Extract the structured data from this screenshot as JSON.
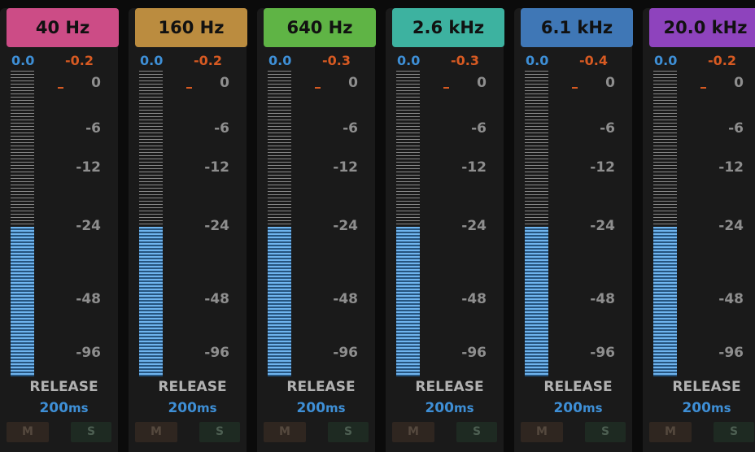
{
  "colors": {
    "gain_value": "#3e8fd6",
    "reduction_value": "#d75a22",
    "meter_active": "#6fb4ee",
    "meter_inactive": "#8a8a8a",
    "scale_text": "#8e8e8e",
    "panel_bg": "#1a1a1a",
    "app_bg": "#0b0b0b"
  },
  "scale": [
    "0",
    "-6",
    "-12",
    "-24",
    "-48",
    "-96"
  ],
  "release_label": "RELEASE",
  "mute_label": "M",
  "solo_label": "S",
  "bands": [
    {
      "label": "40 Hz",
      "color": "#cc4c86",
      "gain": "0.0",
      "reduction": "-0.2",
      "release_value": "200",
      "release_unit": "ms",
      "meter_level_fraction": 0.49
    },
    {
      "label": "160 Hz",
      "color": "#bb8c3f",
      "gain": "0.0",
      "reduction": "-0.2",
      "release_value": "200",
      "release_unit": "ms",
      "meter_level_fraction": 0.49
    },
    {
      "label": "640 Hz",
      "color": "#5fb445",
      "gain": "0.0",
      "reduction": "-0.3",
      "release_value": "200",
      "release_unit": "ms",
      "meter_level_fraction": 0.49
    },
    {
      "label": "2.6 kHz",
      "color": "#3db2a0",
      "gain": "0.0",
      "reduction": "-0.3",
      "release_value": "200",
      "release_unit": "ms",
      "meter_level_fraction": 0.49
    },
    {
      "label": "6.1 kHz",
      "color": "#3f77b6",
      "gain": "0.0",
      "reduction": "-0.4",
      "release_value": "200",
      "release_unit": "ms",
      "meter_level_fraction": 0.49
    },
    {
      "label": "20.0 kHz",
      "color": "#8e43bd",
      "gain": "0.0",
      "reduction": "-0.2",
      "release_value": "200",
      "release_unit": "ms",
      "meter_level_fraction": 0.49
    }
  ]
}
